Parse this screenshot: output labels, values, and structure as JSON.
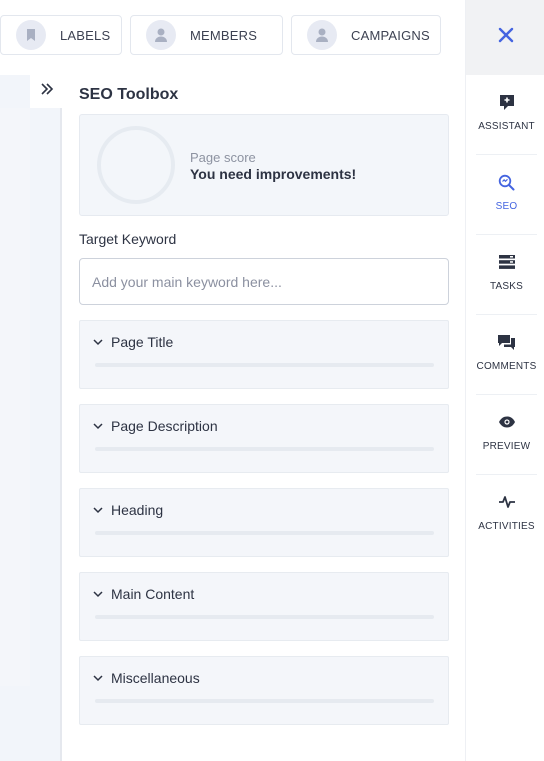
{
  "toolbar": {
    "chips": [
      {
        "label": "LABELS",
        "icon": "bookmark-icon"
      },
      {
        "label": "MEMBERS",
        "icon": "user-icon"
      },
      {
        "label": "CAMPAIGNS",
        "icon": "user-icon"
      }
    ]
  },
  "rail": {
    "close_icon": "close-icon",
    "items": [
      {
        "label": "ASSISTANT",
        "icon": "assistant-icon",
        "active": false
      },
      {
        "label": "SEO",
        "icon": "search-icon",
        "active": true
      },
      {
        "label": "TASKS",
        "icon": "tasks-icon",
        "active": false
      },
      {
        "label": "COMMENTS",
        "icon": "comments-icon",
        "active": false
      },
      {
        "label": "PREVIEW",
        "icon": "eye-icon",
        "active": false
      },
      {
        "label": "ACTIVITIES",
        "icon": "activity-icon",
        "active": false
      }
    ]
  },
  "seo": {
    "title": "SEO Toolbox",
    "score_label": "Page score",
    "score_message": "You need improvements!",
    "keyword_label": "Target Keyword",
    "keyword_placeholder": "Add your main keyword here...",
    "sections": [
      {
        "title": "Page Title"
      },
      {
        "title": "Page Description"
      },
      {
        "title": "Heading"
      },
      {
        "title": "Main Content"
      },
      {
        "title": "Miscellaneous"
      }
    ]
  },
  "colors": {
    "accent": "#4464e0",
    "text": "#2d3343",
    "muted": "#8d93a1",
    "panel_bg": "#f4f6fa",
    "border": "#e6eaf0"
  }
}
